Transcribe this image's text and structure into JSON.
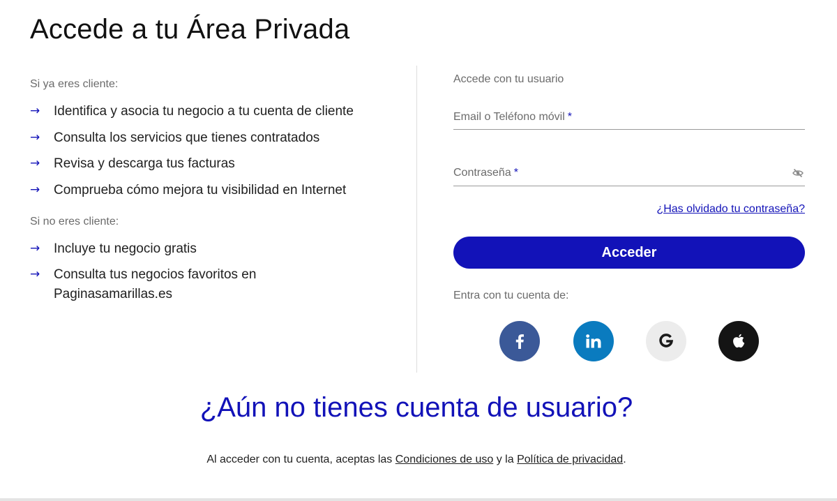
{
  "page": {
    "title": "Accede a tu Área Privada"
  },
  "clients": {
    "label": "Si ya eres cliente:",
    "items": [
      "Identifica y asocia tu negocio a tu cuenta de cliente",
      "Consulta los servicios que tienes contratados",
      "Revisa y descarga tus facturas",
      "Comprueba cómo mejora tu visibilidad en Internet"
    ]
  },
  "non_clients": {
    "label": "Si no eres cliente:",
    "items": [
      "Incluye tu negocio gratis",
      "Consulta tus negocios favoritos en Paginasamarillas.es"
    ]
  },
  "bullet_glyph": "→",
  "login": {
    "heading": "Accede con tu usuario",
    "email_label": "Email o Teléfono móvil",
    "email_value": "",
    "password_label": "Contraseña",
    "password_value": "",
    "required_mark": "*",
    "forgot_link": "¿Has olvidado tu contraseña?",
    "submit_label": "Acceder",
    "social_label": "Entra con tu cuenta de:",
    "social": [
      {
        "name": "facebook",
        "icon": "facebook-icon",
        "color": "#3b5998"
      },
      {
        "name": "linkedin",
        "icon": "linkedin-icon",
        "color": "#0a7bbf"
      },
      {
        "name": "google",
        "icon": "google-icon",
        "color": "#ececec"
      },
      {
        "name": "apple",
        "icon": "apple-icon",
        "color": "#141414"
      }
    ]
  },
  "signup": {
    "title": "¿Aún no tienes cuenta de usuario?"
  },
  "terms": {
    "prefix": "Al acceder con tu cuenta, aceptas las",
    "conditions_link": "Condiciones de uso",
    "connector": "y la",
    "privacy_link": "Política de privacidad",
    "suffix": "."
  },
  "colors": {
    "accent": "#1212b8",
    "muted_text": "#6b6b6b",
    "divider": "#dddddd"
  }
}
